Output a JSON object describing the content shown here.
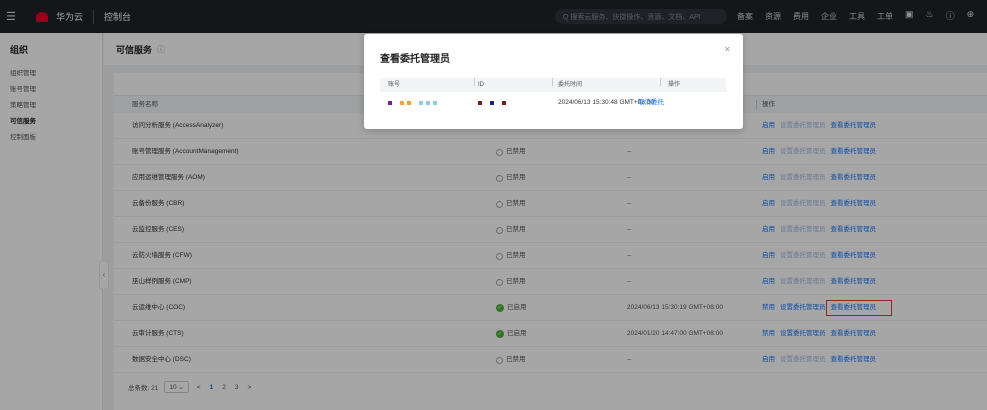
{
  "topbar": {
    "brand": "华为云",
    "logo_text": "HUAWEI",
    "console": "控制台",
    "search_placeholder": "Q  搜索云服务、快捷操作、资源、文档、API",
    "links": [
      "备案",
      "资源",
      "费用",
      "企业",
      "工具",
      "工单"
    ],
    "icon_names": [
      "menu-icon",
      "terminal-icon",
      "bell-icon",
      "help-icon",
      "globe-icon"
    ]
  },
  "sidebar": {
    "title": "组织",
    "items": [
      {
        "label": "组织管理",
        "active": false
      },
      {
        "label": "账号管理",
        "active": false
      },
      {
        "label": "策略管理",
        "active": false
      },
      {
        "label": "可信服务",
        "active": true
      },
      {
        "label": "控制面板",
        "active": false
      }
    ]
  },
  "page": {
    "title": "可信服务"
  },
  "table": {
    "headers": {
      "name": "服务名称",
      "ops": "操作"
    },
    "rows": [
      {
        "name": "访问分析服务 (AccessAnalyzer)",
        "status": "",
        "enabled": false,
        "time": "",
        "ops": [
          "启用",
          "设置委托管理员",
          "查看委托管理员"
        ]
      },
      {
        "name": "账号管理服务 (AccountManagement)",
        "status": "已禁用",
        "enabled": false,
        "time": "--",
        "ops": [
          "启用",
          "设置委托管理员",
          "查看委托管理员"
        ]
      },
      {
        "name": "应用运维管理服务 (AOM)",
        "status": "已禁用",
        "enabled": false,
        "time": "--",
        "ops": [
          "启用",
          "设置委托管理员",
          "查看委托管理员"
        ]
      },
      {
        "name": "云备份服务 (CBR)",
        "status": "已禁用",
        "enabled": false,
        "time": "--",
        "ops": [
          "启用",
          "设置委托管理员",
          "查看委托管理员"
        ]
      },
      {
        "name": "云监控服务 (CES)",
        "status": "已禁用",
        "enabled": false,
        "time": "--",
        "ops": [
          "启用",
          "设置委托管理员",
          "查看委托管理员"
        ]
      },
      {
        "name": "云防火墙服务 (CFW)",
        "status": "已禁用",
        "enabled": false,
        "time": "--",
        "ops": [
          "启用",
          "设置委托管理员",
          "查看委托管理员"
        ]
      },
      {
        "name": "巫山样例服务 (CMP)",
        "status": "已禁用",
        "enabled": false,
        "time": "--",
        "ops": [
          "启用",
          "设置委托管理员",
          "查看委托管理员"
        ]
      },
      {
        "name": "云运维中心 (COC)",
        "status": "已启用",
        "enabled": true,
        "time": "2024/06/13 15:30:19 GMT+08:00",
        "ops": [
          "禁用",
          "设置委托管理员",
          "查看委托管理员"
        ]
      },
      {
        "name": "云审计服务 (CTS)",
        "status": "已启用",
        "enabled": true,
        "time": "2024/01/20 14:47:00 GMT+08:00",
        "ops": [
          "禁用",
          "设置委托管理员",
          "查看委托管理员"
        ]
      },
      {
        "name": "数据安全中心 (DSC)",
        "status": "已禁用",
        "enabled": false,
        "time": "--",
        "ops": [
          "启用",
          "设置委托管理员",
          "查看委托管理员"
        ]
      }
    ]
  },
  "pagination": {
    "total_label": "总条数: 21",
    "page_size": "10",
    "pages": [
      "<",
      "1",
      "2",
      "3",
      ">"
    ],
    "current": "1"
  },
  "modal": {
    "title": "查看委托管理员",
    "headers": [
      "账号",
      "ID",
      "委托时间",
      "操作"
    ],
    "row": {
      "time": "2024/06/13 15:30:48 GMT+08:00",
      "action": "取消委托",
      "account_colors": [
        "#7b1fa2",
        "#f2a33a",
        "#f2a33a",
        "#8ecae6",
        "#8ecae6",
        "#8ecae6"
      ],
      "id_colors": [
        "#7a1a1a",
        "#1a237e",
        "#7a1a1a"
      ]
    }
  },
  "colors": {
    "accent": "#1476ff",
    "enabled": "#52b33e",
    "highlight_border": "#e03b3b",
    "topbar": "#1f2329"
  }
}
